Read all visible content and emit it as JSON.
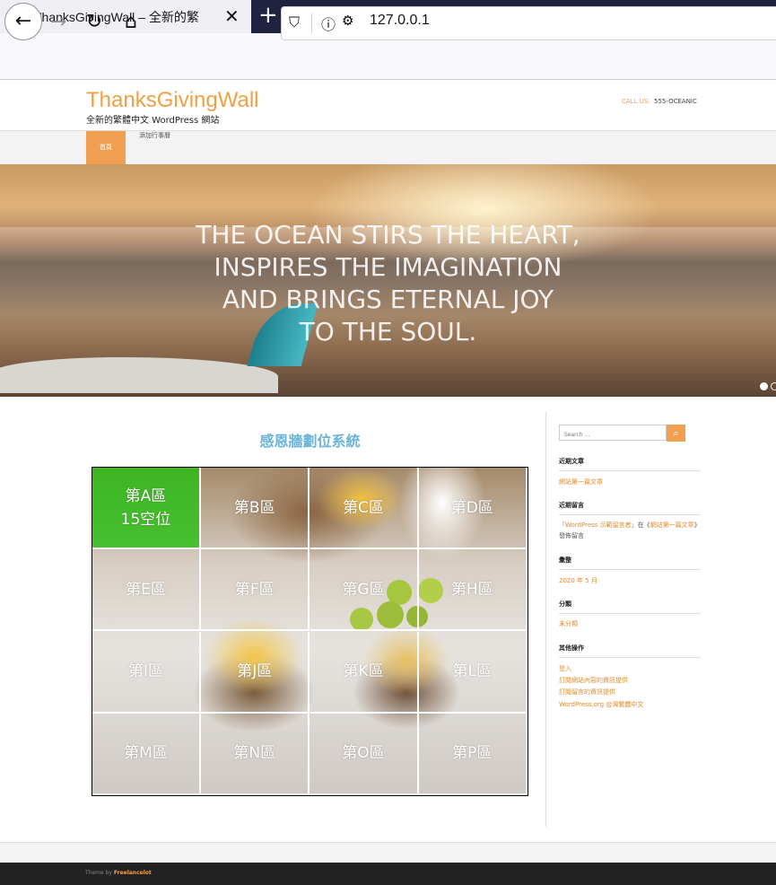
{
  "browser": {
    "tab_title": "ThanksGivingWall – 全新的繁",
    "tab_icon": "wordpress-icon",
    "url": "127.0.0.1"
  },
  "site": {
    "title": "ThanksGivingWall",
    "tagline": "全新的繁體中文 WordPress 網站",
    "call_label": "CALL US:",
    "call_number": "555-OCEANIC"
  },
  "menu": {
    "items": [
      "首頁",
      "添加行事曆"
    ]
  },
  "hero": {
    "lines": [
      "THE OCEAN STIRS THE HEART,",
      "INSPIRES THE IMAGINATION",
      "AND BRINGS ETERNAL JOY",
      "TO THE SOUL."
    ]
  },
  "main": {
    "title": "感恩牆劃位系統",
    "zones": [
      {
        "label": "第A區",
        "extra": "15空位",
        "open": true
      },
      {
        "label": "第B區"
      },
      {
        "label": "第C區"
      },
      {
        "label": "第D區"
      },
      {
        "label": "第E區"
      },
      {
        "label": "第F區"
      },
      {
        "label": "第G區"
      },
      {
        "label": "第H區"
      },
      {
        "label": "第I區"
      },
      {
        "label": "第J區"
      },
      {
        "label": "第K區"
      },
      {
        "label": "第L區"
      },
      {
        "label": "第M區"
      },
      {
        "label": "第N區"
      },
      {
        "label": "第O區"
      },
      {
        "label": "第P區"
      }
    ]
  },
  "sidebar": {
    "search_placeholder": "Search ...",
    "recent_posts_title": "近期文章",
    "recent_posts": [
      "網站第一篇文章"
    ],
    "recent_comments_title": "近期留言",
    "comment": {
      "author": "「WordPress 示範留言者」",
      "mid": "在《",
      "post": "網站第一篇文章",
      "end": "》發佈留言"
    },
    "archives_title": "彙整",
    "archives": [
      "2020 年 5 月"
    ],
    "categories_title": "分類",
    "categories": [
      "未分類"
    ],
    "meta_title": "其他操作",
    "meta": [
      "登入",
      "訂閱網站內容的資訊提供",
      "訂閱留言的資訊提供",
      "WordPress.org 台灣繁體中文"
    ]
  },
  "footer": {
    "prefix": "Theme by",
    "link": "Freelancelot"
  },
  "colors": {
    "accent": "#f0a050",
    "open_zone": "#2cbf14",
    "title_blue": "#6ab4d8"
  }
}
